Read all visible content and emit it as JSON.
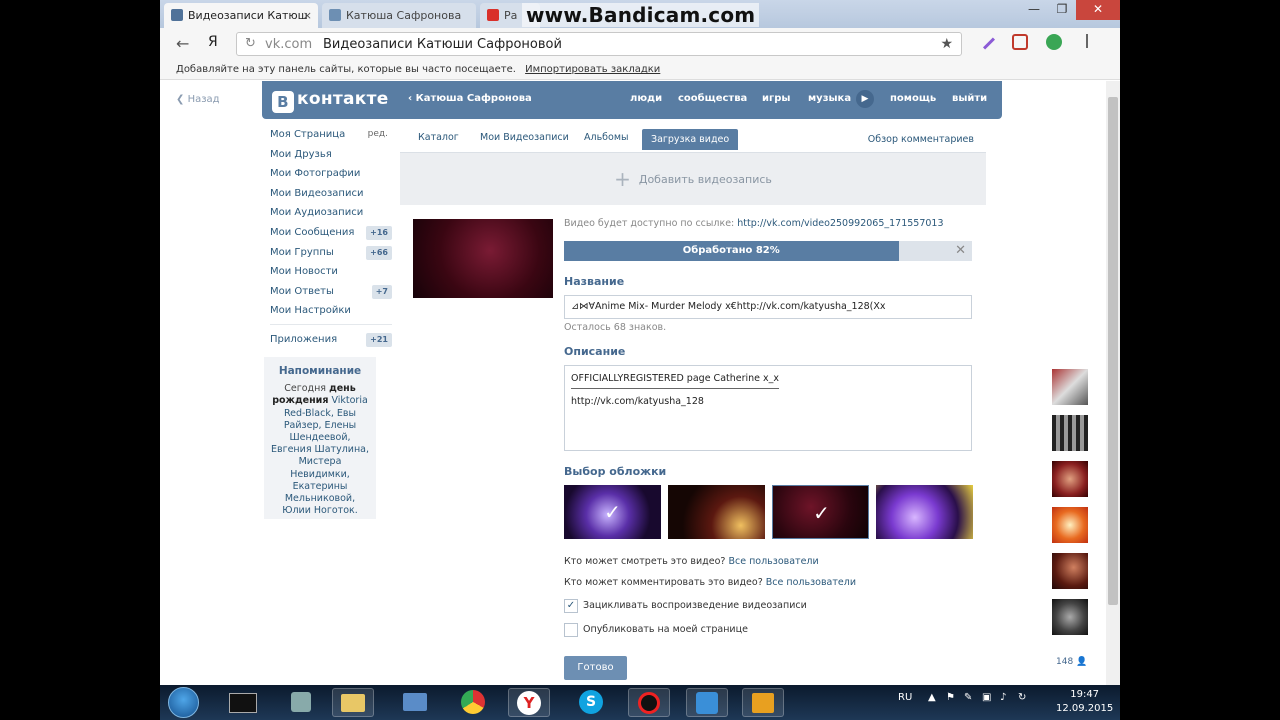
{
  "browser": {
    "tabs": [
      {
        "label": "Видеозаписи Катюш",
        "close": "×"
      },
      {
        "label": "Катюша Сафронова"
      },
      {
        "label": "Ра"
      }
    ],
    "watermark": "www.Bandicam.com",
    "window_buttons": {
      "minimize": "—",
      "maximize": "❐",
      "close": "✕"
    },
    "back_icon": "←",
    "yandex_icon": "Я",
    "reload_icon": "↻",
    "address_host": "vk.com",
    "address_title": "Видеозаписи Катюши Сафроновой",
    "star_icon": "★",
    "bookmarks_text": "Добавляйте на эту панель сайты, которые вы часто посещаете.",
    "bookmarks_link": "Импортировать закладки"
  },
  "vk": {
    "back_label": "Назад",
    "logo_letter": "В",
    "logo_text": "контакте",
    "user": "Катюша Сафронова",
    "nav": {
      "people": "люди",
      "communities": "сообщества",
      "games": "игры",
      "music": "музыка",
      "play": "▶",
      "help": "помощь",
      "logout": "выйти"
    },
    "menu": [
      {
        "label": "Моя Страница",
        "extra": "ред."
      },
      {
        "label": "Мои Друзья"
      },
      {
        "label": "Мои Фотографии"
      },
      {
        "label": "Мои Видеозаписи"
      },
      {
        "label": "Мои Аудиозаписи"
      },
      {
        "label": "Мои Сообщения",
        "badge": "+16"
      },
      {
        "label": "Мои Группы",
        "badge": "+66"
      },
      {
        "label": "Мои Новости"
      },
      {
        "label": "Мои Ответы",
        "badge": "+7"
      },
      {
        "label": "Мои Настройки"
      }
    ],
    "apps": {
      "label": "Приложения",
      "badge": "+21"
    },
    "reminder": {
      "title": "Напоминание",
      "today": "Сегодня",
      "birthday": "день рождения",
      "names": "Viktoria Red-Black, Евы Райзер, Елены Шендеевой, Евгения Шатулина, Мистера Невидимки, Екатерины Мельниковой, Юлии Ноготок."
    },
    "tabs": [
      "Каталог",
      "Мои Видеозаписи",
      "Альбомы",
      "Загрузка видео"
    ],
    "tabs_right": "Обзор комментариев",
    "add_video": "Добавить видеозапись",
    "link_prefix": "Видео будет доступно по ссылке:",
    "link_url": "http://vk.com/video250992065_171557013",
    "progress_label": "Обработано 82%",
    "progress_value": 0.82,
    "close_icon": "✕",
    "name_label": "Название",
    "name_value": "⊿⋈∀Anime Mix- Murder Melody x€http://vk.com/katyusha_128(Xx",
    "chars_left": "Осталось 68 знаков.",
    "desc_label": "Описание",
    "desc_line1": "OFFICIALLYREGISTERED page Catherine x_x",
    "desc_line2": "http://vk.com/katyusha_128",
    "cover_label": "Выбор обложки",
    "who_view_q": "Кто может смотреть это видео?",
    "who_view_a": "Все пользователи",
    "who_comment_q": "Кто может комментировать это видео?",
    "who_comment_a1": "Все",
    "who_comment_a2": "пользователи",
    "loop_label": "Зацикливать воспроизведение видеозаписи",
    "publish_label": "Опубликовать на моей странице",
    "done_label": "Готово",
    "side_count": "148"
  },
  "taskbar": {
    "lang": "RU",
    "time": "19:47",
    "date": "12.09.2015"
  }
}
